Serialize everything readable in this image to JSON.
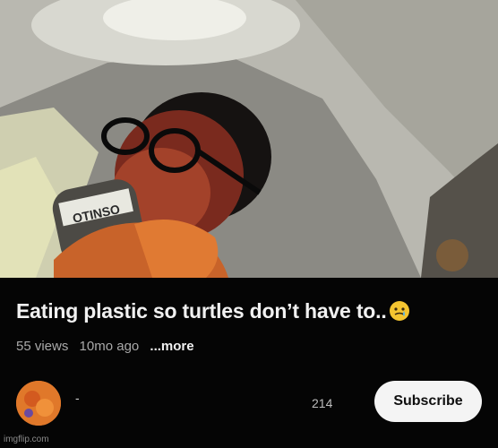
{
  "video": {
    "title": "Eating plastic so turtles don’t have to..",
    "title_emoji_icon": "tearful-smiling-face-icon",
    "views": "55 views",
    "age": "10mo ago",
    "more_label": "...more",
    "thumbnail_can_text": "OTINSO"
  },
  "channel": {
    "name": "-",
    "subscriber_count": "214",
    "subscribe_label": "Subscribe"
  },
  "watermark": "imgflip.com",
  "colors": {
    "background": "#050505",
    "subscribe_button": "#f4f4f4",
    "avatar": "#e0782a"
  }
}
